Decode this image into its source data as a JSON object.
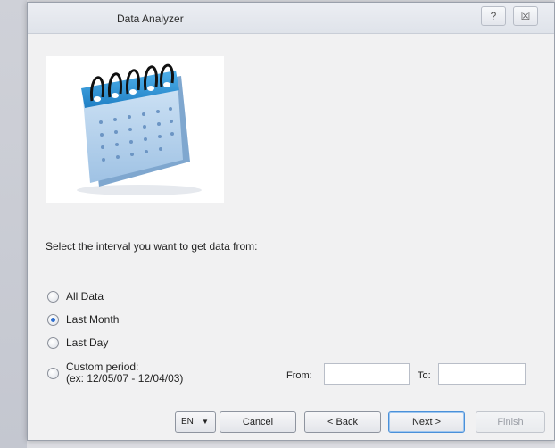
{
  "window": {
    "title": "Data Analyzer",
    "help_glyph": "?",
    "close_glyph": "☒"
  },
  "instruction": "Select the interval you want to get data from:",
  "options": [
    {
      "label": "All Data",
      "checked": false
    },
    {
      "label": "Last Month",
      "checked": true
    },
    {
      "label": "Last Day",
      "checked": false
    },
    {
      "label": "Custom period:",
      "sublabel": "(ex: 12/05/07 - 12/04/03)",
      "checked": false
    }
  ],
  "fields": {
    "from_label": "From:",
    "to_label": "To:",
    "from_value": "",
    "to_value": ""
  },
  "buttons": {
    "language": "EN",
    "cancel": "Cancel",
    "back": "< Back",
    "next": "Next >",
    "finish": "Finish"
  },
  "colors": {
    "accent": "#2f6fcf",
    "calendar_blue": "#3a9ad9"
  }
}
